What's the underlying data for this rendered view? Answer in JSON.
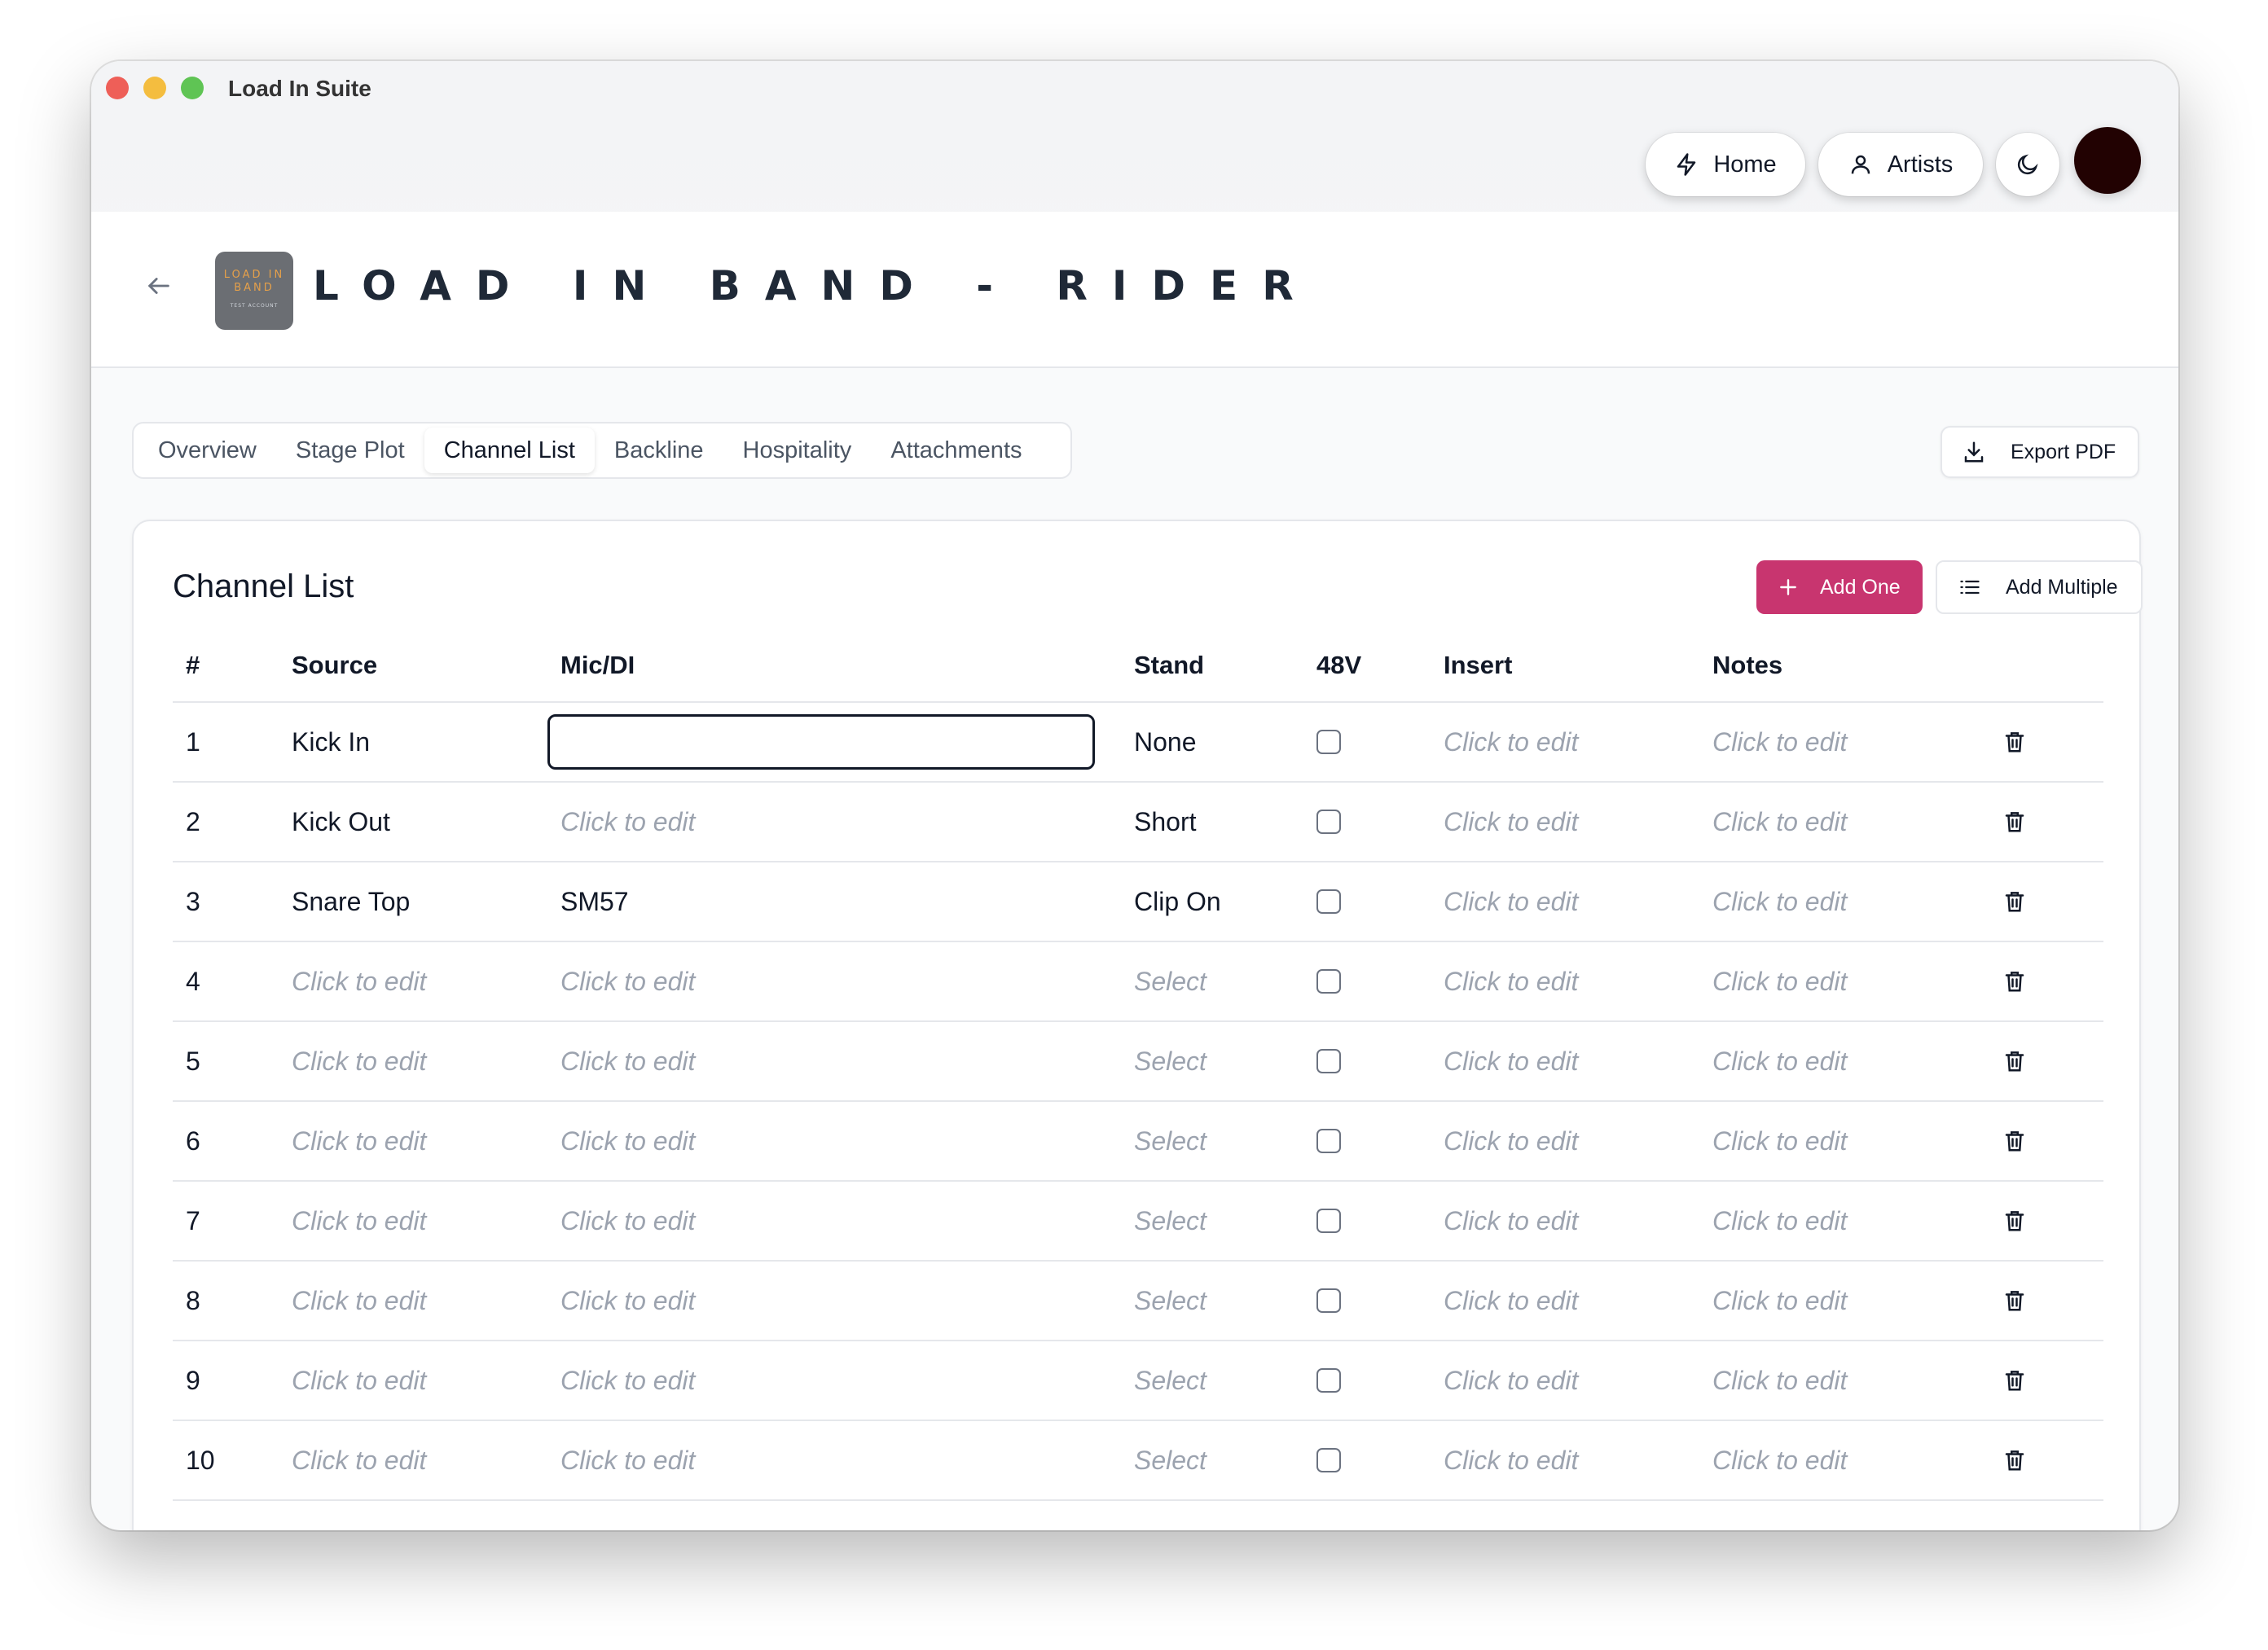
{
  "window": {
    "title": "Load In Suite"
  },
  "nav": {
    "home": "Home",
    "artists": "Artists"
  },
  "header": {
    "logo_line1": "LOAD IN",
    "logo_line2": "BAND",
    "logo_line3": "TEST ACCOUNT",
    "title": "LOAD IN BAND - RIDER"
  },
  "tabs": [
    "Overview",
    "Stage Plot",
    "Channel List",
    "Backline",
    "Hospitality",
    "Attachments"
  ],
  "active_tab": "Channel List",
  "export_label": "Export PDF",
  "card": {
    "title": "Channel List",
    "add_one": "Add One",
    "add_multiple": "Add Multiple"
  },
  "columns": [
    "#",
    "Source",
    "Mic/DI",
    "Stand",
    "48V",
    "Insert",
    "Notes"
  ],
  "rows": [
    {
      "num": "1",
      "source": "Kick In",
      "mic": "",
      "stand": "None",
      "insert": "Click to edit",
      "notes": "Click to edit"
    },
    {
      "num": "2",
      "source": "Kick Out",
      "mic": "Click to edit",
      "stand": "Short",
      "insert": "Click to edit",
      "notes": "Click to edit"
    },
    {
      "num": "3",
      "source": "Snare Top",
      "mic": "SM57",
      "stand": "Clip On",
      "insert": "Click to edit",
      "notes": "Click to edit"
    },
    {
      "num": "4",
      "source": "Click to edit",
      "mic": "Click to edit",
      "stand": "Select",
      "insert": "Click to edit",
      "notes": "Click to edit"
    },
    {
      "num": "5",
      "source": "Click to edit",
      "mic": "Click to edit",
      "stand": "Select",
      "insert": "Click to edit",
      "notes": "Click to edit"
    },
    {
      "num": "6",
      "source": "Click to edit",
      "mic": "Click to edit",
      "stand": "Select",
      "insert": "Click to edit",
      "notes": "Click to edit"
    },
    {
      "num": "7",
      "source": "Click to edit",
      "mic": "Click to edit",
      "stand": "Select",
      "insert": "Click to edit",
      "notes": "Click to edit"
    },
    {
      "num": "8",
      "source": "Click to edit",
      "mic": "Click to edit",
      "stand": "Select",
      "insert": "Click to edit",
      "notes": "Click to edit"
    },
    {
      "num": "9",
      "source": "Click to edit",
      "mic": "Click to edit",
      "stand": "Select",
      "insert": "Click to edit",
      "notes": "Click to edit"
    },
    {
      "num": "10",
      "source": "Click to edit",
      "mic": "Click to edit",
      "stand": "Select",
      "insert": "Click to edit",
      "notes": "Click to edit"
    }
  ],
  "colors": {
    "accent": "#c8356f",
    "avatar": "#220202",
    "placeholder": "#9ca3af"
  },
  "icons": {
    "home": "lightning-icon",
    "artists": "user-icon",
    "theme": "moon-icon",
    "back": "arrow-left-icon",
    "export": "download-icon",
    "add_one": "plus-icon",
    "add_multiple": "list-icon",
    "row_action": "trash-icon"
  }
}
